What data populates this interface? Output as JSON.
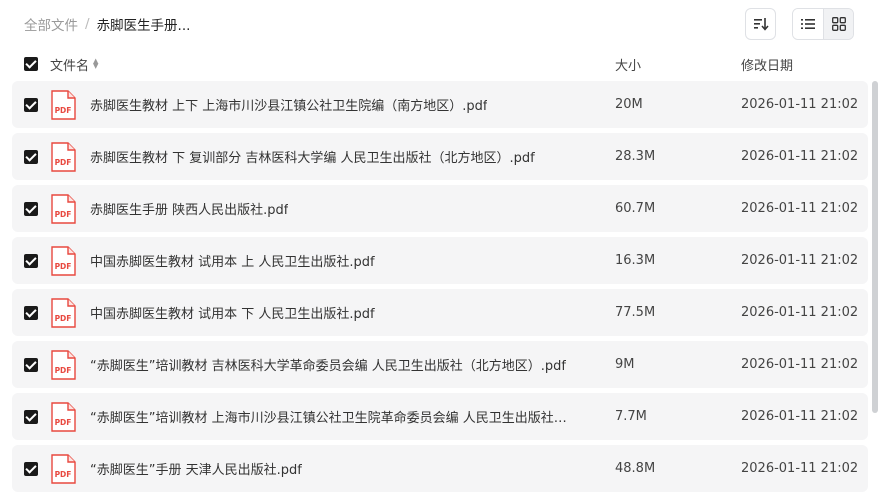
{
  "breadcrumb": {
    "root": "全部文件",
    "separator": "/",
    "current": "赤脚医生手册..."
  },
  "toolbar": {
    "sort_icon": "sort-descending-icon",
    "list_icon": "list-view-icon",
    "grid_icon": "grid-view-icon"
  },
  "table": {
    "headers": {
      "name": "文件名",
      "size": "大小",
      "date": "修改日期"
    },
    "file_icon": "pdf-icon",
    "pdf_label": "PDF",
    "rows": [
      {
        "name": "赤脚医生教材 上下 上海市川沙县江镇公社卫生院编（南方地区）.pdf",
        "size": "20M",
        "date": "2026-01-11 21:02"
      },
      {
        "name": "赤脚医生教材 下 复训部分 吉林医科大学编 人民卫生出版社（北方地区）.pdf",
        "size": "28.3M",
        "date": "2026-01-11 21:02"
      },
      {
        "name": "赤脚医生手册 陕西人民出版社.pdf",
        "size": "60.7M",
        "date": "2026-01-11 21:02"
      },
      {
        "name": "中国赤脚医生教材 试用本 上 人民卫生出版社.pdf",
        "size": "16.3M",
        "date": "2026-01-11 21:02"
      },
      {
        "name": "中国赤脚医生教材 试用本 下 人民卫生出版社.pdf",
        "size": "77.5M",
        "date": "2026-01-11 21:02"
      },
      {
        "name": "“赤脚医生”培训教材 吉林医科大学革命委员会编 人民卫生出版社（北方地区）.pdf",
        "size": "9M",
        "date": "2026-01-11 21:02"
      },
      {
        "name": "“赤脚医生”培训教材 上海市川沙县江镇公社卫生院革命委员会编 人民卫生出版社（南...",
        "size": "7.7M",
        "date": "2026-01-11 21:02"
      },
      {
        "name": "“赤脚医生”手册 天津人民出版社.pdf",
        "size": "48.8M",
        "date": "2026-01-11 21:02"
      }
    ]
  },
  "colors": {
    "pdf_red": "#e8483f",
    "checkbox": "#1a1a1a",
    "row_bg": "#f5f5f6"
  }
}
